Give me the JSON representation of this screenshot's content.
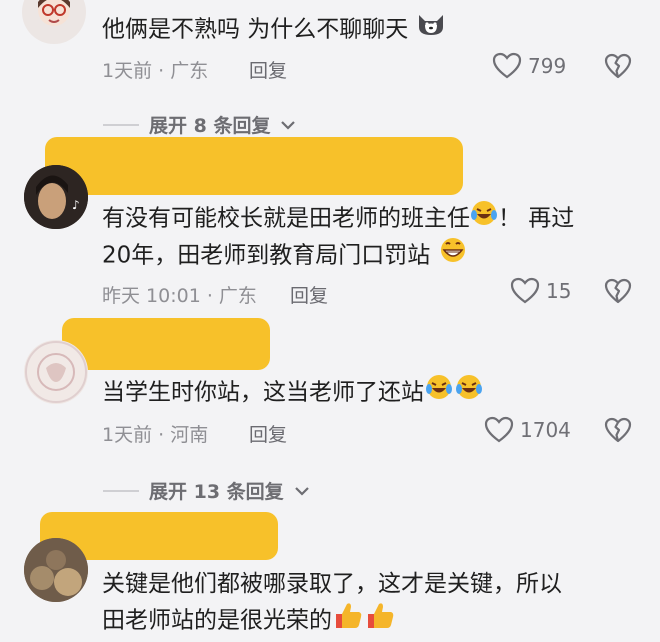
{
  "comment1": {
    "text": "他俩是不熟吗  为什么不聊聊天",
    "time_location": "1天前 · 广东",
    "reply": "回复",
    "likes": "799"
  },
  "expand1": {
    "label": "展开 8 条回复"
  },
  "comment2": {
    "line1": "有没有可能校长就是田老师的班主任",
    "line1_tail": "！ 再过",
    "line2": "20年，田老师到教育局门口罚站",
    "time_location": "昨天 10:01 · 广东",
    "reply": "回复",
    "likes": "15"
  },
  "comment3": {
    "text": "当学生时你站，这当老师了还站",
    "time_location": "1天前 · 河南",
    "reply": "回复",
    "likes": "1704"
  },
  "expand2": {
    "label": "展开 13 条回复"
  },
  "comment4": {
    "line1": "关键是他们都被哪录取了，这才是关键，所以",
    "line2": "田老师站的是很光荣的"
  },
  "colors": {
    "background": "#f3f3f5",
    "redaction": "#f7c12a",
    "meta": "#8f8f94"
  }
}
